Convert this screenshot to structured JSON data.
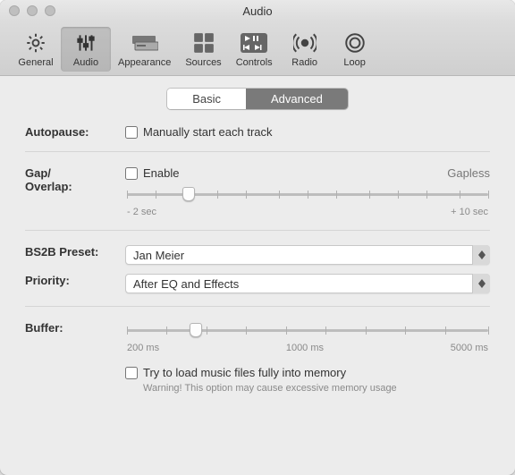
{
  "window": {
    "title": "Audio"
  },
  "toolbar": {
    "items": [
      {
        "label": "General"
      },
      {
        "label": "Audio"
      },
      {
        "label": "Appearance"
      },
      {
        "label": "Sources"
      },
      {
        "label": "Controls"
      },
      {
        "label": "Radio"
      },
      {
        "label": "Loop"
      }
    ],
    "selected_index": 1
  },
  "tabs": {
    "basic": "Basic",
    "advanced": "Advanced",
    "active": "advanced"
  },
  "autopause": {
    "label": "Autopause:",
    "checkbox_label": "Manually start each track",
    "checked": false
  },
  "gap": {
    "label": "Gap/\nOverlap:",
    "enable_label": "Enable",
    "enable_checked": false,
    "gapless_label": "Gapless",
    "min_label": "- 2 sec",
    "max_label": "+ 10 sec",
    "thumb_percent": 17
  },
  "bs2b": {
    "label": "BS2B Preset:",
    "value": "Jan Meier"
  },
  "priority": {
    "label": "Priority:",
    "value": "After EQ and Effects"
  },
  "buffer": {
    "label": "Buffer:",
    "min_label": "200 ms",
    "mid_label": "1000 ms",
    "max_label": "5000 ms",
    "thumb_percent": 19
  },
  "memory": {
    "checkbox_label": "Try to load music files fully into memory",
    "checked": false,
    "warning": "Warning! This option may cause excessive memory usage"
  }
}
